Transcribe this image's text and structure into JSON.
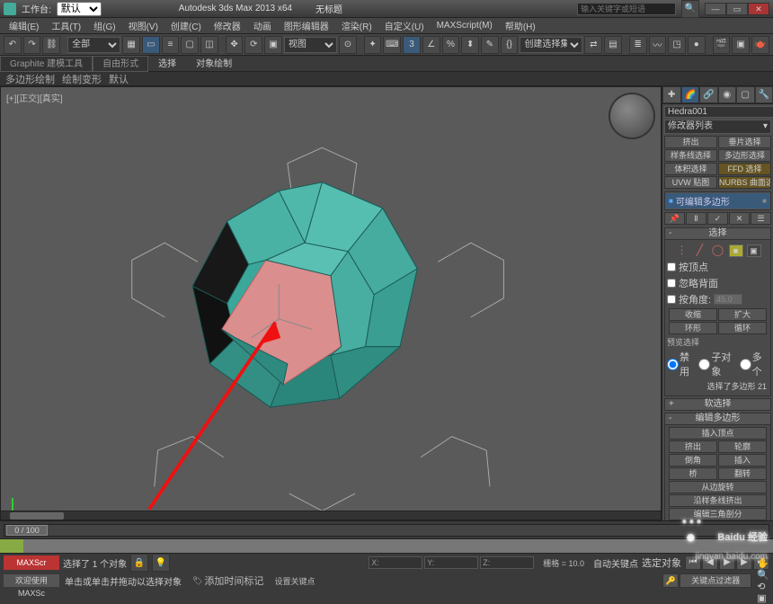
{
  "title": {
    "workspace_label": "工作台:",
    "workspace_value": "默认",
    "app": "Autodesk 3ds Max  2013 x64",
    "doc": "无标题",
    "search_placeholder": "输入关键字或短语"
  },
  "winbtns": {
    "min": "—",
    "max": "▭",
    "close": "✕"
  },
  "menubar": [
    "编辑(E)",
    "工具(T)",
    "组(G)",
    "视图(V)",
    "创建(C)",
    "修改器",
    "动画",
    "图形编辑器",
    "渲染(R)",
    "自定义(U)",
    "MAXScript(M)",
    "帮助(H)"
  ],
  "toolbars": {
    "sel_set": "全部",
    "view_label": "视图",
    "create_sel": "创建选择集"
  },
  "ribbon": {
    "tabs": [
      "Graphite 建模工具",
      "自由形式",
      "选择",
      "对象绘制"
    ],
    "row": [
      "多边形绘制",
      "绘制变形",
      "默认"
    ]
  },
  "viewport": {
    "label": "[+][正交][真实]"
  },
  "timeline": {
    "frame": "0 / 100"
  },
  "cmdpanel": {
    "obj_name": "Hedra001",
    "mod_list_label": "修改器列表",
    "quick_btns": [
      [
        "挤出",
        "垂片选择"
      ],
      [
        "样条线选择",
        "多边形选择"
      ],
      [
        "体积选择",
        "FFD 选择"
      ],
      [
        "UVW 贴图",
        "NURBS 曲面选择"
      ]
    ],
    "stack_item": "可编辑多边形",
    "sel_rollout": "选择",
    "cb_byvertex": "按顶点",
    "cb_ignoreback": "忽略背面",
    "cb_byangle": "按角度:",
    "angle_val": "45.0",
    "btns": {
      "shrink": "收缩",
      "grow": "扩大",
      "ring": "环形",
      "loop": "循环"
    },
    "preview_label": "预览选择",
    "preview_opts": [
      "禁用",
      "子对象",
      "多个"
    ],
    "sel_count": "选择了多边形 21",
    "soft_sel": "软选择",
    "edit_poly": "编辑多边形",
    "insert_vert": "插入顶点",
    "ep_btns": [
      [
        "挤出",
        "轮廓"
      ],
      [
        "倒角",
        "插入"
      ]
    ],
    "bridge": "桥",
    "flip": "翻转",
    "from_edge": "从边旋转",
    "along_spline": "沿样条线挤出",
    "edit_tri": "编辑三角剖分"
  },
  "status": {
    "macro": "MAXScr",
    "sel_text": "选择了 1 个对象",
    "x": "X:",
    "y": "Y:",
    "z": "Z:",
    "grid": "栅格 = 10.0",
    "autokey": "自动关键点",
    "setkey": "设置关键点",
    "keyfilter": "关键点过滤器",
    "selset": "选定对象",
    "welcome": "欢迎使用 MAXSc",
    "prompt": "单击或单击并拖动以选择对象",
    "addtime": "添加时间标记"
  },
  "watermark": {
    "brand": "Baidu 经验",
    "url": "jingyan.baidu.com"
  }
}
